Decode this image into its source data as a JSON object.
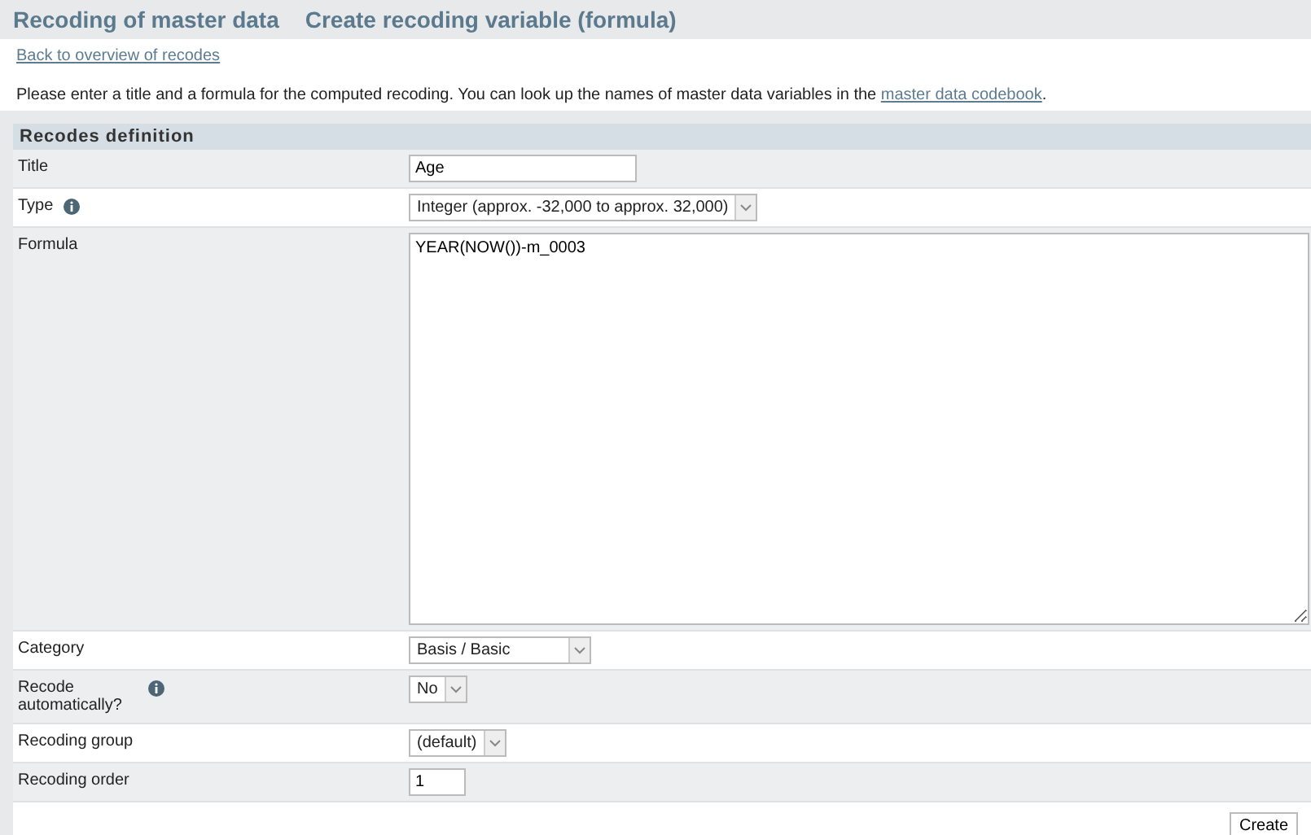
{
  "header": {
    "title": "Recoding of master data",
    "subtitle": "Create recoding variable (formula)"
  },
  "back_link": "Back to overview of recodes",
  "intro": {
    "text": "Please enter a title and a formula for the computed recoding. You can look up the names of master data variables in the ",
    "link": "master data codebook",
    "end": "."
  },
  "section_title": "Recodes definition",
  "fields": [
    {
      "label": "Title",
      "kind": "text",
      "value": "Age",
      "info": false
    },
    {
      "label": "Type",
      "kind": "select",
      "value": "Integer (approx. -32,000 to approx. 32,000)",
      "info": true
    },
    {
      "label": "Formula",
      "kind": "textarea",
      "value": "YEAR(NOW())-m_0003",
      "info": false
    },
    {
      "label": "Category",
      "kind": "select",
      "value": "Basis / Basic",
      "info": false
    },
    {
      "label": "Recode automatically?",
      "kind": "select",
      "value": "No",
      "info": true
    },
    {
      "label": "Recoding group",
      "kind": "select",
      "value": "(default)",
      "info": false
    },
    {
      "label": "Recoding order",
      "kind": "text",
      "value": "1",
      "info": false
    }
  ],
  "submit": "Create"
}
